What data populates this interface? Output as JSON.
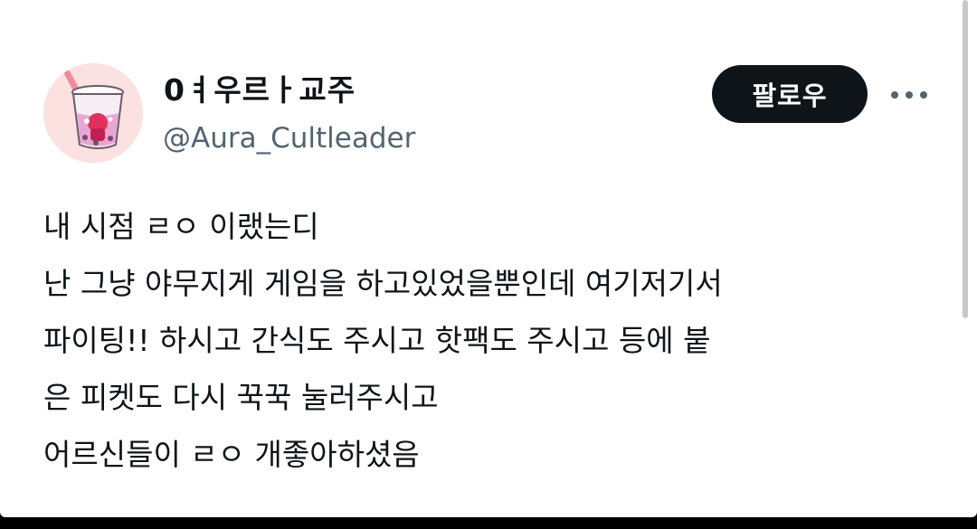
{
  "post": {
    "author": {
      "display_name": "0ㅕ우르ㅏ교주",
      "handle": "@Aura_Cultleader",
      "avatar_icon": "bubble-tea-avatar-icon"
    },
    "follow_label": "팔로우",
    "more_icon": "more-dots-icon",
    "lines": [
      "내 시점 ㄹㅇ 이랬는디",
      "난 그냥 야무지게 게임을 하고있었을뿐인데 여기저기서",
      "파이팅!! 하시고 간식도 주시고 핫팩도 주시고 등에 붙",
      "은 피켓도 다시 꾹꾹 눌러주시고",
      "어르신들이 ㄹㅇ 개좋아하셨음"
    ]
  },
  "colors": {
    "text": "#0f1419",
    "secondary_text": "#536471",
    "button_bg": "#0f1419",
    "button_text": "#ffffff",
    "background": "#ffffff",
    "frame": "#000000"
  }
}
